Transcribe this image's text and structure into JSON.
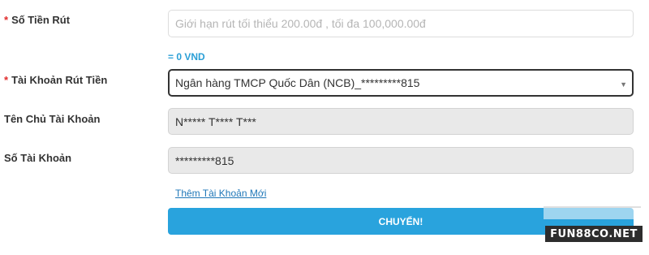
{
  "form": {
    "amount": {
      "label": "Số Tiền Rút",
      "required_mark": "*",
      "placeholder": "Giới hạn rút tối thiểu 200.00đ , tối đa 100,000.00đ",
      "conversion_text": "= 0 VND"
    },
    "account": {
      "label": "Tài Khoản Rút Tiền",
      "required_mark": "*",
      "selected_value": "Ngân hàng TMCP Quốc Dân (NCB)_*********815",
      "icon": "caret-down-icon",
      "caret_glyph": "▼"
    },
    "holder_name": {
      "label": "Tên Chủ Tài Khoản",
      "value": "N***** T**** T***"
    },
    "account_number": {
      "label": "Số Tài Khoản",
      "value": "*********815"
    },
    "add_account_link": "Thêm Tài Khoản Mới",
    "submit_label": "CHUYỂN!"
  },
  "watermark": {
    "text": "FUN88CO.NET"
  },
  "colors": {
    "accent": "#29a3dd",
    "link": "#1f77b8",
    "required": "#e02b2b",
    "readonly_bg": "#e9e9e9"
  }
}
